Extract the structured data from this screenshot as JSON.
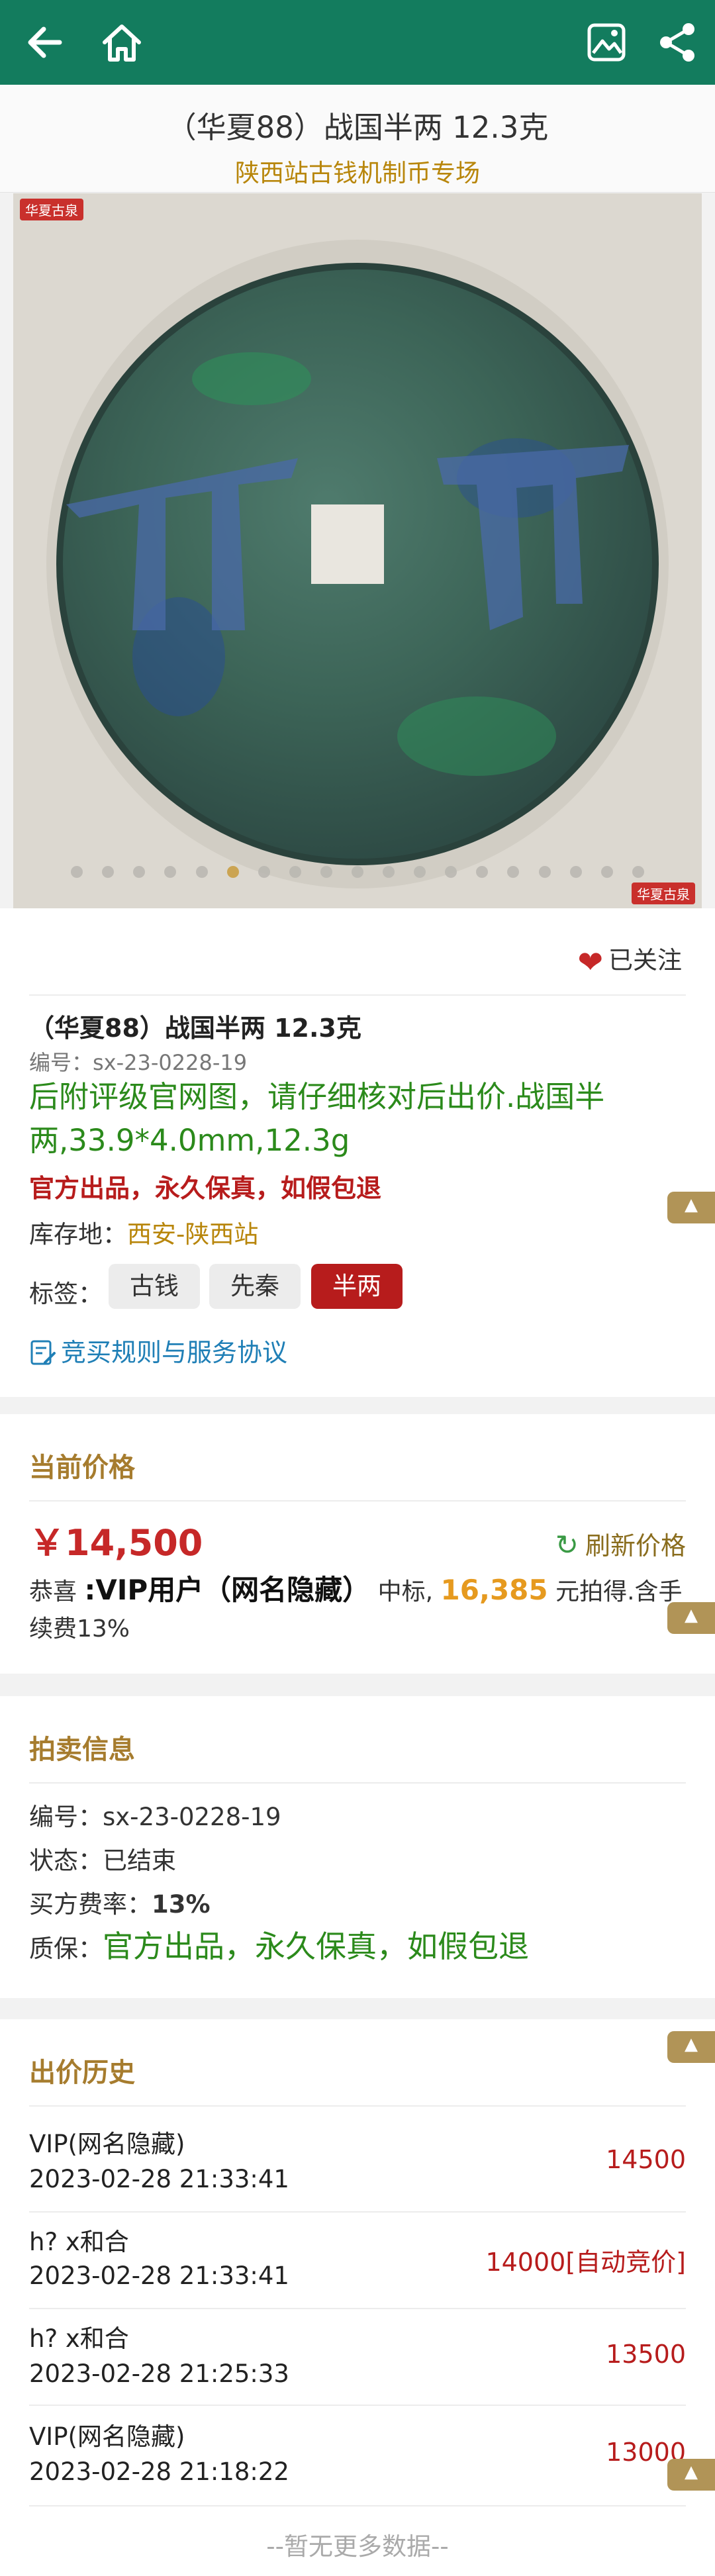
{
  "topbar": {
    "back_icon": "back-arrow-icon",
    "home_icon": "home-icon",
    "gallery_icon": "image-gallery-icon",
    "share_icon": "share-icon",
    "color": "#137c5e"
  },
  "header": {
    "title": "（华夏88）战国半两 12.3克",
    "subtitle": "陕西站古钱机制币专场"
  },
  "photo": {
    "watermark": "华夏古泉",
    "dot_count": 19,
    "active_dot": 5
  },
  "item": {
    "follow_label": "已关注",
    "title": "（华夏88）战国半两 12.3克",
    "number": "编号：sx-23-0228-19",
    "description": "后附评级官网图，请仔细核对后出价.战国半两,33.9*4.0mm,12.3g",
    "guarantee": "官方出品，永久保真，如假包退",
    "store_label": "库存地：",
    "store_value": "西安-陕西站",
    "tags_label": "标签：",
    "tags": [
      "古钱",
      "先秦",
      "半两"
    ],
    "rules_link": "竞买规则与服务协议"
  },
  "price": {
    "section_title": "当前价格",
    "current": "￥14,500",
    "refresh_label": "刷新价格",
    "winner_prefix": "恭喜",
    "winner_name": ":VIP用户（网名隐藏）",
    "winner_mid": "中标,",
    "winner_amount": "16,385",
    "winner_suffix": "元拍得.含手续费13%"
  },
  "auction": {
    "section_title": "拍卖信息",
    "rows": [
      {
        "label": "编号：",
        "value": "sx-23-0228-19"
      },
      {
        "label": "状态：",
        "value": "已结束"
      },
      {
        "label": "买方费率：",
        "value": "13%"
      },
      {
        "label": "质保：",
        "value": "官方出品，永久保真，如假包退"
      }
    ]
  },
  "history": {
    "section_title": "出价历史",
    "bids": [
      {
        "name": "VIP(网名隐藏)",
        "time": "2023-02-28 21:33:41",
        "price": "14500"
      },
      {
        "name": "h? x和合",
        "time": "2023-02-28 21:33:41",
        "price": "14000[自动竞价]"
      },
      {
        "name": "h? x和合",
        "time": "2023-02-28 21:25:33",
        "price": "13500"
      },
      {
        "name": "VIP(网名隐藏)",
        "time": "2023-02-28 21:18:22",
        "price": "13000"
      }
    ],
    "no_more": "--暂无更多数据--"
  }
}
